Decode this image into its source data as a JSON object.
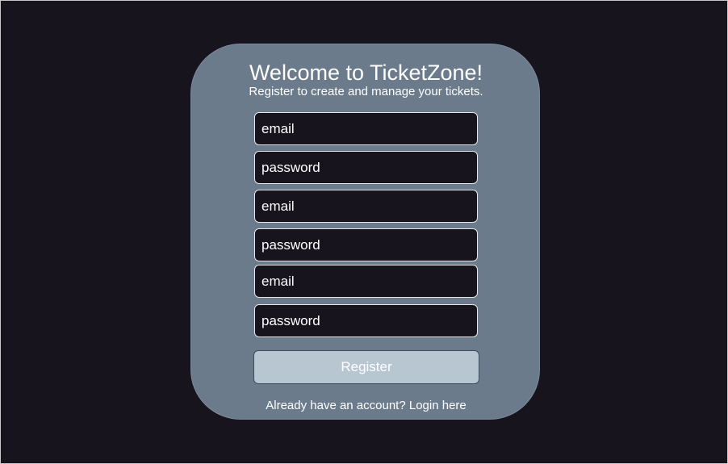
{
  "card": {
    "title": "Welcome to TicketZone!",
    "subtitle": "Register to create and manage your tickets."
  },
  "form": {
    "fields": [
      {
        "placeholder": "email",
        "type": "email"
      },
      {
        "placeholder": "password",
        "type": "password"
      },
      {
        "placeholder": "email",
        "type": "email"
      },
      {
        "placeholder": "password",
        "type": "password"
      },
      {
        "placeholder": "email",
        "type": "email"
      },
      {
        "placeholder": "password",
        "type": "password"
      }
    ],
    "submit_label": "Register"
  },
  "footer": {
    "prompt": "Already have an account? ",
    "link_label": "Login here"
  },
  "colors": {
    "background": "#17141d",
    "card": "#6b7b8c",
    "button": "#b8c6d2"
  }
}
